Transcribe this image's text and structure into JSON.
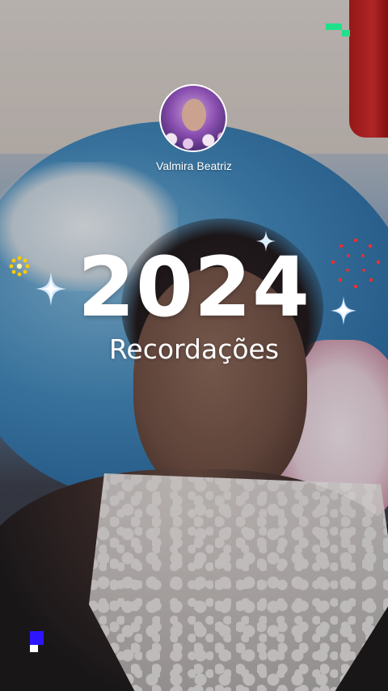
{
  "profile": {
    "name": "Valmira Beatriz"
  },
  "title": {
    "year": "2024",
    "subtitle": "Recordações"
  },
  "colors": {
    "sparkle": "#cfe4ff",
    "fireworks_red": "#ff2b2b",
    "flower_yellow": "#ffcc00",
    "pixel_green": "#1fe08a",
    "pixel_blue": "#2d16ff"
  },
  "icons": [
    "sparkle-icon",
    "fireworks-icon",
    "flower-icon",
    "pixel-block-icon"
  ]
}
